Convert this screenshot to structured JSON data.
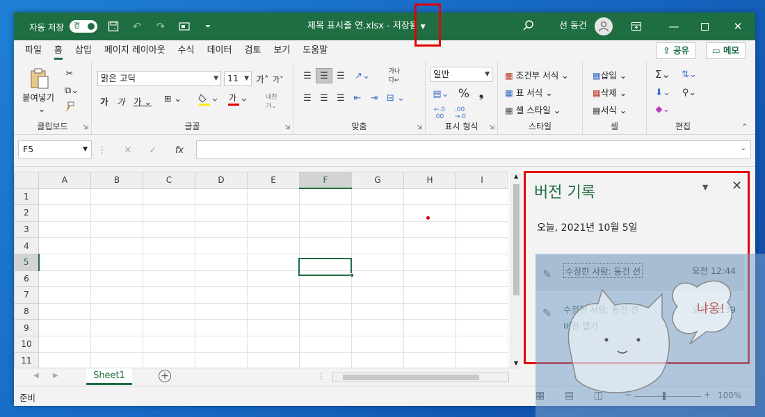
{
  "titlebar": {
    "autosave_label": "자동 저장",
    "autosave_toggle": "켬",
    "doc_title": "제목 표시줄 연.xlsx - 저장됨",
    "user_name": "선 동건"
  },
  "tabs": [
    "파일",
    "홈",
    "삽입",
    "페이지 레이아웃",
    "수식",
    "데이터",
    "검토",
    "보기",
    "도움말"
  ],
  "share_label": "공유",
  "memo_label": "메모",
  "ribbon": {
    "paste_label": "붙여넣기",
    "clipboard_label": "클립보드",
    "font_name": "맑은 고딕",
    "font_size": "11",
    "font_group_label": "글꼴",
    "align_group_label": "맞춤",
    "number_format": "일반",
    "number_group_label": "표시 형식",
    "cond_format": "조건부 서식",
    "table_format": "표 서식",
    "cell_style": "셀 스타일",
    "style_group_label": "스타일",
    "insert": "삽입",
    "delete": "삭제",
    "format": "서식",
    "cells_group_label": "셀",
    "edit_group_label": "편집"
  },
  "namebox": "F5",
  "columns": [
    "A",
    "B",
    "C",
    "D",
    "E",
    "F",
    "G",
    "H",
    "I"
  ],
  "rows": [
    "1",
    "2",
    "3",
    "4",
    "5",
    "6",
    "7",
    "8",
    "9",
    "10",
    "11"
  ],
  "sheet_tab": "Sheet1",
  "status": {
    "ready": "준비",
    "zoom": "100%"
  },
  "version_pane": {
    "title": "버전 기록",
    "date": "오늘, 2021년 10월 5일",
    "items": [
      {
        "editor": "수정한 사람: 동건 선",
        "time": "오전 12:44"
      },
      {
        "editor": "수정한 사람: 동건 선",
        "time": "오전 12:39",
        "open": "버전 열기"
      }
    ]
  },
  "overlay_text": "냐옹!",
  "colors": {
    "excel_green": "#1e6e42",
    "highlight_red": "#e30000"
  }
}
